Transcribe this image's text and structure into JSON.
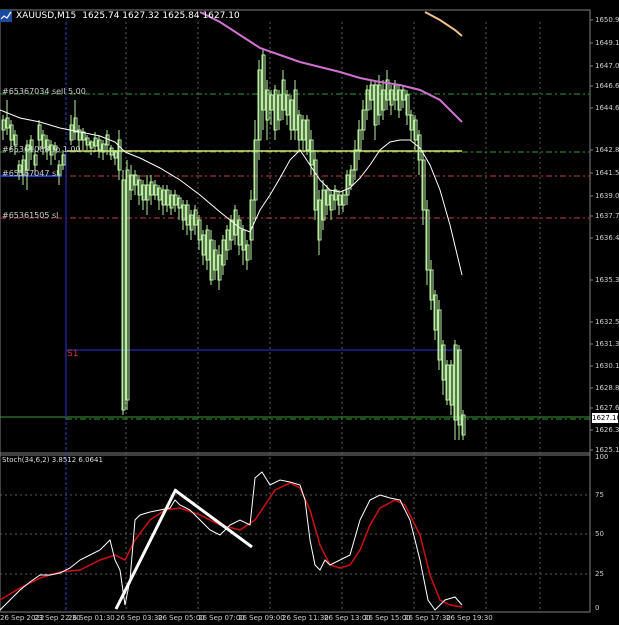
{
  "window": {
    "title": "XAUUSD,M15",
    "ohlc": "1625.74 1627.32 1625.84 1627.10",
    "icon": "chart-window-icon"
  },
  "price_axis": {
    "labels": [
      "1650.90",
      "1649.10",
      "1647.00",
      "1646.60",
      "1644.60",
      "1642.80",
      "1641.50",
      "1639.00",
      "1637.70",
      "1636.45",
      "1635.35",
      "1632.55",
      "1631.35",
      "1630.10",
      "1628.85",
      "1627.60",
      "1626.35",
      "1625.10"
    ],
    "current_price": "1627.10"
  },
  "oscillator": {
    "title": "Stoch(34,6,2) 3.8512 6.0641",
    "levels": [
      "100",
      "75",
      "50",
      "25",
      "0"
    ]
  },
  "time_axis": {
    "labels": [
      "26 Sep 2022",
      "23 Sep 22:30",
      "26 Sep 01:30",
      "26 Sep 03:30",
      "26 Sep 05:00",
      "26 Sep 07:00",
      "26 Sep 09:00",
      "26 Sep 11:30",
      "26 Sep 13:00",
      "26 Sep 15:00",
      "26 Sep 17:30",
      "26 Sep 19:30"
    ]
  },
  "order_lines": {
    "sell": "#65367034 sell 5.00",
    "tp": "#65361088 tp 1.00",
    "sl1": "#65367047 sl",
    "sl2": "#65361505 sl",
    "s1": "S1"
  },
  "colors": {
    "candle_bull": "#b8f0a0",
    "candle_bear": "#b8f0a0",
    "ma_fast": "#ffffff",
    "ma_slow": "#d070d0",
    "ma_long": "#f0c090",
    "level_yellow": "#e0e070",
    "level_green_dash": "#3a9a3a",
    "level_red_dash": "#c04040",
    "level_blue": "#202090",
    "stoch_main": "#ffffff",
    "stoch_signal": "#d01010"
  }
}
